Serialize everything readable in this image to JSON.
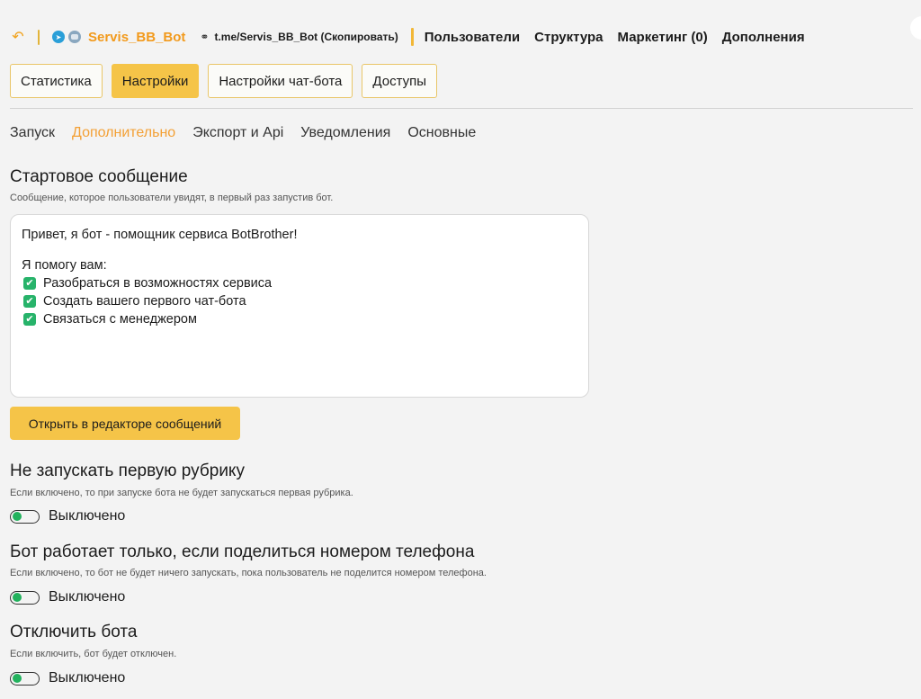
{
  "header": {
    "bot_name": "Servis_BB_Bot",
    "bot_link": "t.me/Servis_BB_Bot (Скопировать)",
    "nav": [
      "Пользователи",
      "Структура",
      "Маркетинг (0)",
      "Дополнения"
    ],
    "icons": {
      "back": "back-arrow-icon",
      "telegram": "telegram-icon",
      "avatar": "bot-avatar",
      "link": "link-icon"
    }
  },
  "tabs": [
    {
      "label": "Статистика",
      "active": false
    },
    {
      "label": "Настройки",
      "active": true
    },
    {
      "label": "Настройки чат-бота",
      "active": false
    },
    {
      "label": "Доступы",
      "active": false
    }
  ],
  "subtabs": [
    {
      "label": "Запуск",
      "active": false
    },
    {
      "label": "Дополнительно",
      "active": true
    },
    {
      "label": "Экспорт и Api",
      "active": false
    },
    {
      "label": "Уведомления",
      "active": false
    },
    {
      "label": "Основные",
      "active": false
    }
  ],
  "start_message": {
    "title": "Стартовое сообщение",
    "description": "Сообщение, которое пользователи увидят, в первый раз запустив бот.",
    "text_line1": "Привет, я бот - помощник сервиса BotBrother!",
    "text_line2": "Я помогу вам:",
    "checklist": [
      "Разобраться в возможностях сервиса",
      "Создать вашего первого чат-бота",
      "Связаться с менеджером"
    ],
    "button": "Открыть в редакторе сообщений"
  },
  "settings": [
    {
      "title": "Не запускать первую рубрику",
      "description": "Если включено, то при запуске бота не будет запускаться первая рубрика.",
      "state_label": "Выключено"
    },
    {
      "title": "Бот работает только, если поделиться номером телефона",
      "description": "Если включено, то бот не будет ничего запускать, пока пользователь не поделится номером телефона.",
      "state_label": "Выключено"
    },
    {
      "title": "Отключить бота",
      "description": "Если включить, бот будет отключен.",
      "state_label": "Выключено"
    }
  ],
  "colors": {
    "accent": "#f5c448",
    "brand_orange": "#f29a1c",
    "toggle_green": "#22b25d",
    "check_green": "#27b36a"
  }
}
